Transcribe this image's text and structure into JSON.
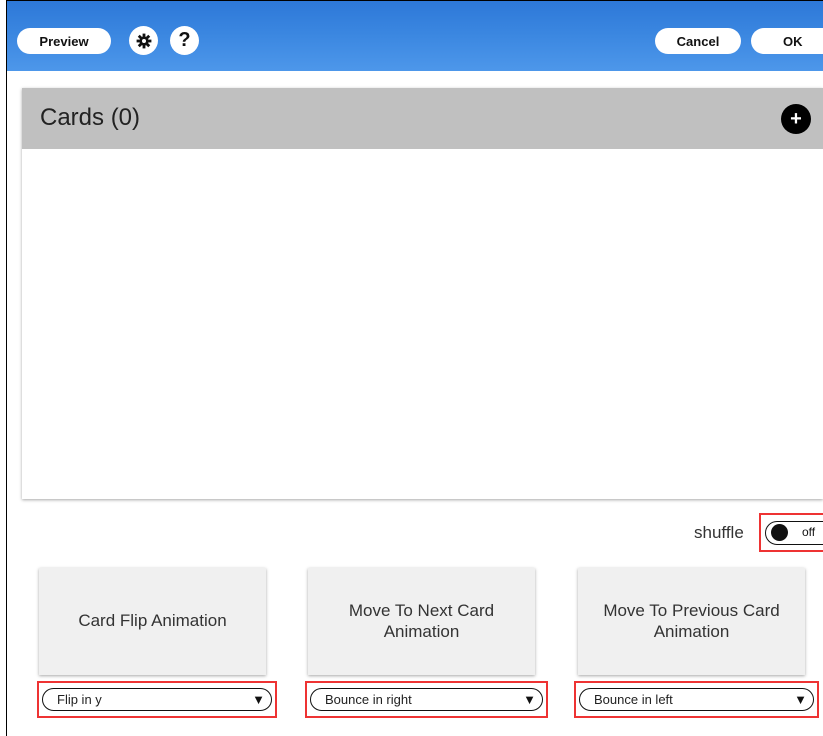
{
  "toolbar": {
    "preview_label": "Preview",
    "cancel_label": "Cancel",
    "ok_label": "OK",
    "settings_icon": "gear-icon",
    "help_label": "?"
  },
  "cards": {
    "title": "Cards (0)",
    "add_label": "+"
  },
  "shuffle": {
    "label": "shuffle",
    "state": "off"
  },
  "animations": [
    {
      "title": "Card Flip Animation",
      "selected": "Flip in y"
    },
    {
      "title": "Move To Next Card Animation",
      "selected": "Bounce in right"
    },
    {
      "title": "Move To Previous Card Animation",
      "selected": "Bounce in left"
    }
  ],
  "colors": {
    "topbar": "#3a86e0",
    "highlight": "#e33333",
    "header_gray": "#c0c0c0"
  }
}
